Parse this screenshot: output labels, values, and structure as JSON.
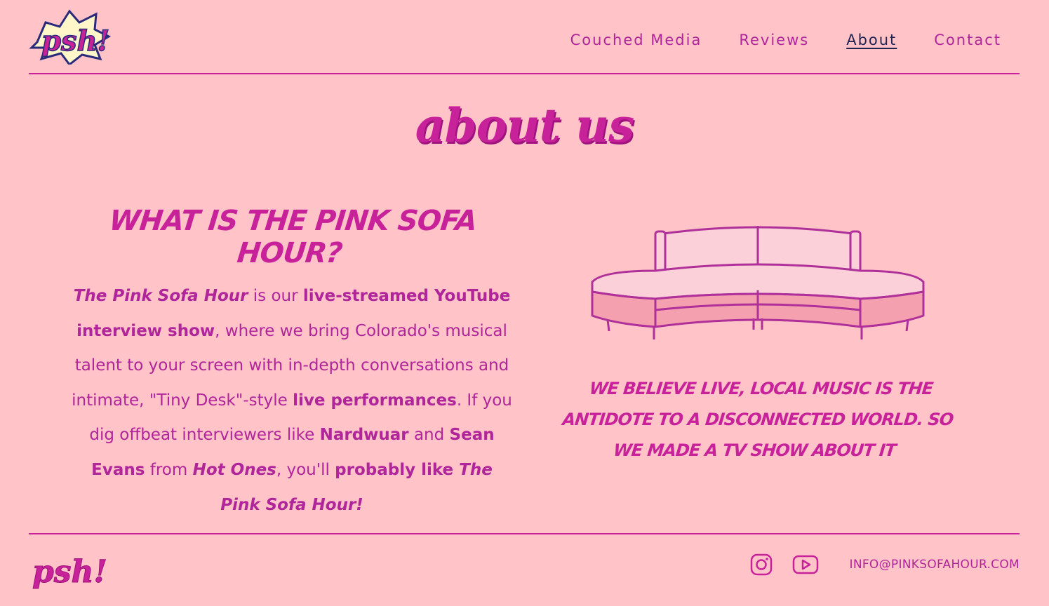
{
  "header": {
    "logo_text": "psh!",
    "nav": [
      {
        "label": "Couched Media"
      },
      {
        "label": "Reviews"
      },
      {
        "label": "About",
        "active": true
      },
      {
        "label": "Contact"
      }
    ]
  },
  "main": {
    "title": "about us",
    "heading": "WHAT IS THE PINK SOFA HOUR?",
    "intro": {
      "show_name": "The Pink Sofa Hour",
      "t1": " is our ",
      "b1": "live-streamed YouTube interview show",
      "t2": ", where we bring Colorado's musical talent to your screen with in-depth conversations and intimate, \"Tiny Desk\"-style ",
      "b2": "live performances",
      "t3": ". If you dig offbeat interviewers like ",
      "b3": "Nardwuar",
      "t4": " and ",
      "b4": "Sean Evans",
      "t5": " from ",
      "i1": "Hot Ones",
      "t6": ", you'll ",
      "b5": "probably like ",
      "i2": "The Pink Sofa Hour!"
    },
    "tagline": "WE BELIEVE LIVE, LOCAL MUSIC IS THE ANTIDOTE TO A DISCONNECTED WORLD. SO WE MADE A TV SHOW ABOUT IT"
  },
  "footer": {
    "logo_text": "psh!",
    "email": "INFO@PINKSOFAHOUR.COM",
    "social_icons": [
      "instagram-icon",
      "youtube-icon"
    ]
  },
  "colors": {
    "background": "#ffc3c8",
    "accent": "#c8229a",
    "text": "#b0259a",
    "active_nav": "#1f2350"
  }
}
